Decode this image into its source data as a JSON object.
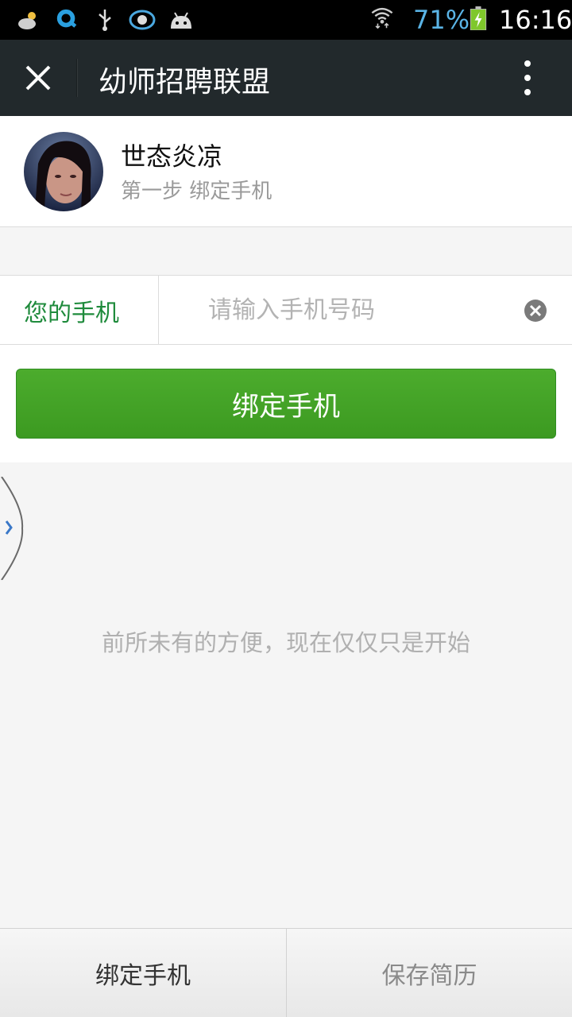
{
  "status_bar": {
    "battery_percent": "71%",
    "time": "16:16",
    "icons": [
      "weather-icon",
      "qq-browser-icon",
      "usb-icon",
      "qq-icon",
      "android-icon",
      "wifi-icon",
      "battery-charging-icon"
    ]
  },
  "title_bar": {
    "title": "幼师招聘联盟",
    "close_icon": "close-icon",
    "menu_icon": "more-vertical-icon"
  },
  "profile": {
    "name": "世态炎凉",
    "step": "第一步 绑定手机"
  },
  "phone_form": {
    "label": "您的手机",
    "placeholder": "请输入手机号码",
    "value": ""
  },
  "bind_button": {
    "label": "绑定手机"
  },
  "slogan": "前所未有的方便，现在仅仅只是开始",
  "bottom_bar": {
    "left_label": "绑定手机",
    "right_label": "保存简历"
  },
  "colors": {
    "accent_green": "#43a325",
    "label_green": "#1f8b3c",
    "titlebar_bg": "#22292c"
  }
}
